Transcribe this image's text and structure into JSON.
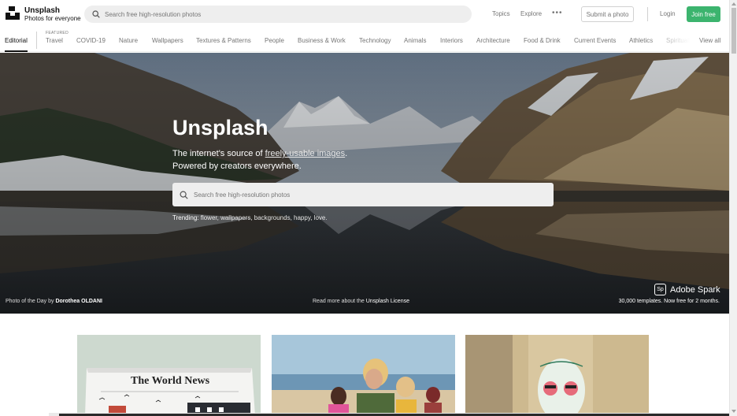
{
  "header": {
    "brand_name": "Unsplash",
    "brand_tagline": "Photos for everyone",
    "search_placeholder": "Search free high-resolution photos",
    "nav": {
      "topics": "Topics",
      "explore": "Explore"
    },
    "submit_label": "Submit a photo",
    "login_label": "Login",
    "join_label": "Join free"
  },
  "tabs": {
    "featured_label": "FEATURED",
    "items": [
      "Editorial",
      "Travel",
      "COVID-19",
      "Nature",
      "Wallpapers",
      "Textures & Patterns",
      "People",
      "Business & Work",
      "Technology",
      "Animals",
      "Interiors",
      "Architecture",
      "Food & Drink",
      "Current Events",
      "Athletics",
      "Spirituality",
      "View all"
    ]
  },
  "hero": {
    "title": "Unsplash",
    "subtitle_pre": "The internet's source of ",
    "subtitle_link": "freely-usable images",
    "subtitle_post": ".",
    "subtitle_line2": "Powered by creators everywhere.",
    "search_placeholder": "Search free high-resolution photos",
    "trending_label": "Trending:",
    "trending_values": "flower, wallpapers, backgrounds, happy, love",
    "credit_prefix": "Photo of the Day",
    "credit_by": "by",
    "credit_author": "Dorothea OLDANI",
    "license_pre": "Read more about the",
    "license_link": "Unsplash License",
    "sponsor_name": "Adobe Spark",
    "sponsor_badge": "Sp",
    "sponsor_text": "30,000 templates. Now free for 2 months."
  },
  "photos": {
    "newspaper_title": "The World News"
  },
  "colors": {
    "accent_green": "#3cb46e",
    "text_muted": "#767676"
  }
}
